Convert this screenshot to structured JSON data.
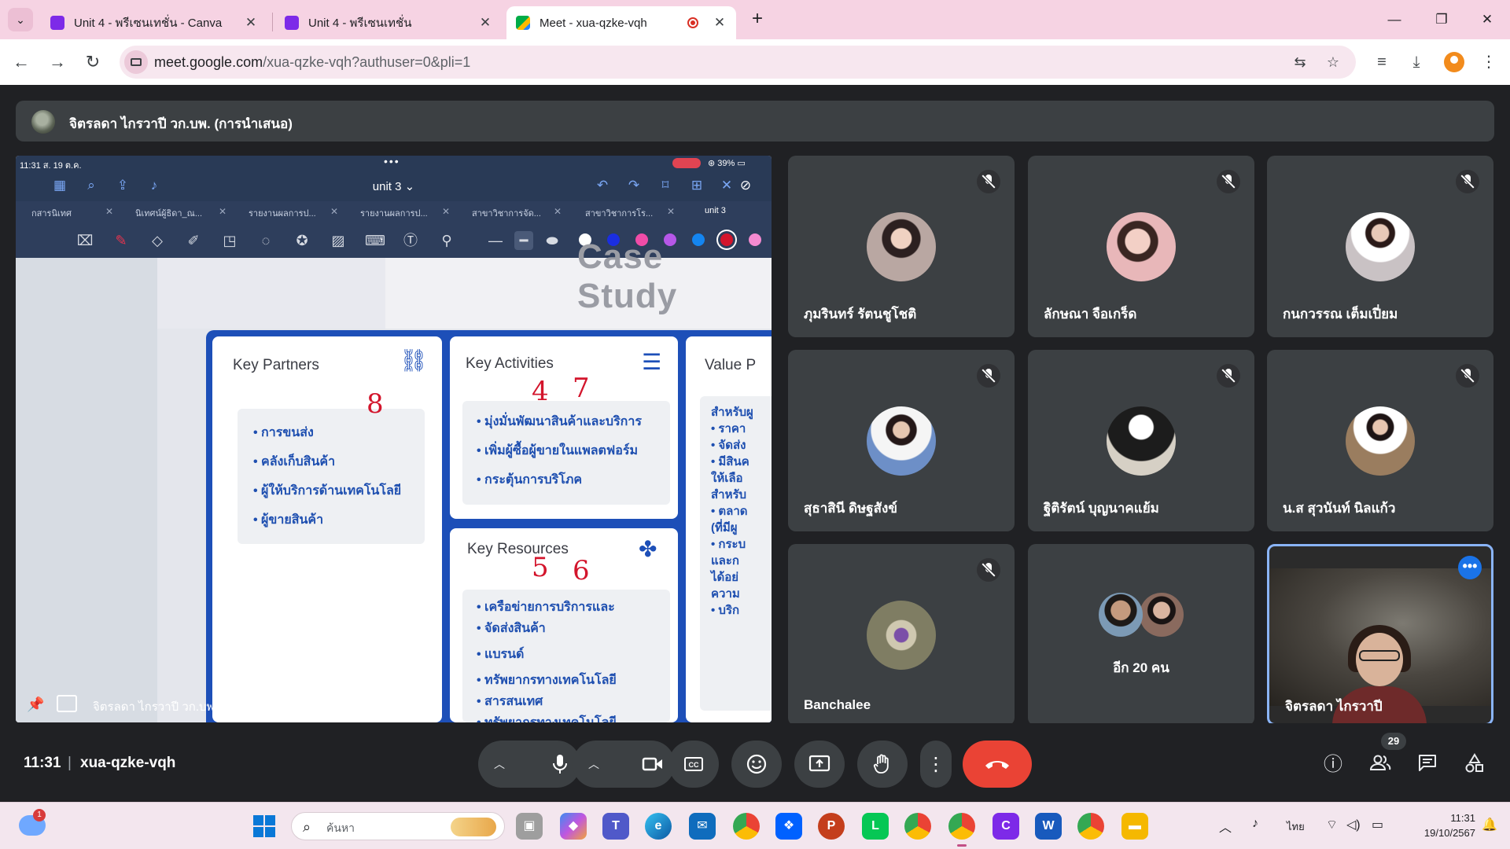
{
  "browser": {
    "tabs": [
      {
        "title": "Unit 4 - พรีเซนเทชั่น - Canva",
        "favicon": "canva-icon",
        "favicon_color": "#7d2ae8"
      },
      {
        "title": "Unit 4 - พรีเซนเทชั่น",
        "favicon": "canva-icon",
        "favicon_color": "#7d2ae8"
      },
      {
        "title": "Meet - xua-qzke-vqh",
        "favicon": "google-meet-icon",
        "favicon_color": "#00ac47",
        "active": true,
        "recording": true
      }
    ],
    "url_host": "meet.google.com",
    "url_path": "/xua-qzke-vqh?authuser=0&pli=1",
    "accent_color": "#f6d3e3"
  },
  "presenter": {
    "title": "จิตรลดา ไกรวาปี วก.บพ. (การนำเสนอ)"
  },
  "shared_screen": {
    "status_time": "11:31  ส. 19 ต.ค.",
    "battery": "39%",
    "doc_title": "unit 3 ⌄",
    "open_tabs": [
      "กสารนิเทศ",
      "นิเทศน์ผู้ธิดา_ณ...",
      "รายงานผลการป...",
      "รายงานผลการป...",
      "สาขาวิชาการจัด...",
      "สาขาวิชาการโร...",
      "unit 3"
    ],
    "slide_heading": "Case Study",
    "key_partners": {
      "title": "Key Partners",
      "items": [
        "การขนส่ง",
        "คลังเก็บสินค้า",
        "ผู้ให้บริการด้านเทคโนโลยี",
        "ผู้ขายสินค้า"
      ]
    },
    "key_activities": {
      "title": "Key Activities",
      "items": [
        "มุ่งมั่นพัฒนาสินค้าและบริการ",
        "เพิ่มผู้ซื้อผู้ขายในแพลตฟอร์ม",
        "กระตุ้นการบริโภค"
      ]
    },
    "key_resources": {
      "title": "Key Resources",
      "items": [
        "เครือข่ายการบริการและ",
        "จัดส่งสินค้า",
        "แบรนด์",
        "ทรัพยากรทางเทคโนโลยี",
        "สารสนเทศ",
        "ทรัพยากรทางเทคโนโลยี"
      ]
    },
    "value_title": "Value P",
    "value_fragments": [
      "สำหรับผู",
      "• ราคา",
      "• จัดส่ง",
      "• มีสินค",
      "ให้เลือ",
      "สำหรับ",
      "• ตลาด",
      "(ที่มีผู",
      "• กระบ",
      "และก",
      "ได้อย่",
      "ความ",
      "• บริก"
    ],
    "annotations": [
      "8",
      "4",
      "7",
      "5",
      "6"
    ],
    "presenter_label": "จิตรลดา ไกรวาปี วก.บพ.",
    "annotation_color": "#d3152c",
    "card_border_color": "#1d4fb8"
  },
  "participants": [
    {
      "name": "ภุมรินทร์ รัตนชูโชติ",
      "muted": true,
      "avatar_color": "#b9a7a2"
    },
    {
      "name": "ลักษณา จือเกร็ด",
      "muted": true,
      "avatar_color": "#e8b7b9"
    },
    {
      "name": "กนกวรรณ เต็มเปี่ยม",
      "muted": true,
      "avatar_color": "#c9c2c4"
    },
    {
      "name": "สุธาสินี ดิษฐสังข์",
      "muted": true,
      "avatar_color": "#6d8fc7"
    },
    {
      "name": "ฐิติรัตน์ บุญนาคแย้ม",
      "muted": true,
      "avatar_color": "#d6d0c5"
    },
    {
      "name": "น.ส สุวนันท์ นิลแก้ว",
      "muted": true,
      "avatar_color": "#9a7d5f"
    },
    {
      "name": "Banchalee",
      "muted": true,
      "avatar_color": "#7f7d63"
    }
  ],
  "others_tile": {
    "label": "อีก 20 คน"
  },
  "self_tile": {
    "name": "จิตรลดา ไกรวาปี"
  },
  "bottom_bar": {
    "time": "11:31",
    "separator": "|",
    "meeting_code": "xua-qzke-vqh",
    "people_count": "29",
    "end_call_color": "#ea4335"
  },
  "taskbar": {
    "weather_badge": "1",
    "search_placeholder": "ค้นหา",
    "language": "ไทย",
    "clock_time": "11:31",
    "clock_date": "19/10/2567",
    "apps": [
      {
        "name": "task-view-icon",
        "color": "#7a7a7a",
        "glyph": "▣"
      },
      {
        "name": "copilot-icon",
        "color": "#6b7fe0",
        "glyph": "◆"
      },
      {
        "name": "teams-icon",
        "color": "#5059c9",
        "glyph": "T"
      },
      {
        "name": "edge-icon",
        "color": "#1b9de2",
        "glyph": "e"
      },
      {
        "name": "mail-icon",
        "color": "#0f6cbd",
        "glyph": "✉"
      },
      {
        "name": "chrome-icon",
        "color": "#34a853",
        "glyph": "◉"
      },
      {
        "name": "dropbox-icon",
        "color": "#0061ff",
        "glyph": "❖"
      },
      {
        "name": "powerpoint-icon",
        "color": "#c43e1c",
        "glyph": "P"
      },
      {
        "name": "line-icon",
        "color": "#06c755",
        "glyph": "L"
      },
      {
        "name": "chrome-icon",
        "color": "#34a853",
        "glyph": "◉"
      },
      {
        "name": "chrome-icon",
        "color": "#34a853",
        "glyph": "◉",
        "active": true
      },
      {
        "name": "canva-icon",
        "color": "#7d2ae8",
        "glyph": "C"
      },
      {
        "name": "word-icon",
        "color": "#185abd",
        "glyph": "W"
      },
      {
        "name": "chrome-icon",
        "color": "#34a853",
        "glyph": "◉"
      },
      {
        "name": "file-explorer-icon",
        "color": "#f5b800",
        "glyph": "▬"
      }
    ]
  }
}
